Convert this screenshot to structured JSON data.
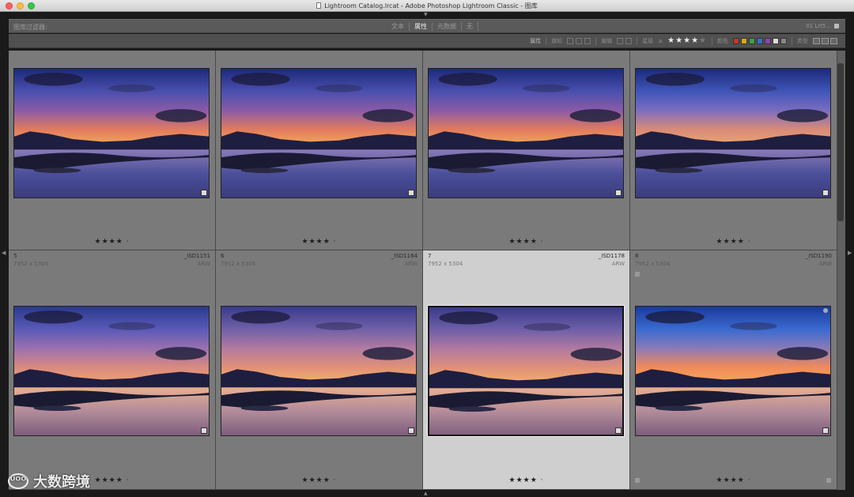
{
  "window": {
    "title": "Lightroom Catalog.lrcat - Adobe Photoshop Lightroom Classic - 图库"
  },
  "filterbar": {
    "label": "图库过滤器:",
    "tabs": [
      {
        "label": "文本",
        "active": false
      },
      {
        "label": "属性",
        "active": true
      },
      {
        "label": "元数据",
        "active": false
      },
      {
        "label": "无",
        "active": false
      }
    ],
    "preset": "01 Lrt5..."
  },
  "attrbar": {
    "attribute_label": "属性",
    "flag_label": "旗标",
    "edit_label": "编辑",
    "rating_label": "星级",
    "rating_op": "≥",
    "rating_stars": "★★★★",
    "rating_dim_star": "★",
    "color_label": "颜色",
    "type_label": "类型",
    "colors": [
      "#c0392b",
      "#d4b106",
      "#3fa142",
      "#3a6fcf",
      "#8e44ad",
      "#dddddd",
      "#888888"
    ]
  },
  "grid": {
    "rows": [
      [
        {
          "index": "",
          "filename": "",
          "dims": "",
          "ext": "",
          "rating": "★★★★ ·",
          "variant": "a"
        },
        {
          "index": "",
          "filename": "",
          "dims": "",
          "ext": "",
          "rating": "★★★★ ·",
          "variant": "a"
        },
        {
          "index": "",
          "filename": "",
          "dims": "",
          "ext": "",
          "rating": "★★★★ ·",
          "variant": "a"
        },
        {
          "index": "",
          "filename": "",
          "dims": "",
          "ext": "",
          "rating": "★★★★ ·",
          "variant": "b"
        }
      ],
      [
        {
          "index": "5",
          "filename": "_ISD1151",
          "dims": "7952 x 5304",
          "ext": "ARW",
          "rating": "★★★★ ·",
          "variant": "c"
        },
        {
          "index": "6",
          "filename": "_ISD1164",
          "dims": "7952 x 5304",
          "ext": "ARW",
          "rating": "★★★★ ·",
          "variant": "d"
        },
        {
          "index": "7",
          "filename": "_ISD1178",
          "dims": "7952 x 5304",
          "ext": "ARW",
          "rating": "★★★★ ·",
          "variant": "d",
          "selected": true
        },
        {
          "index": "8",
          "filename": "_ISD1190",
          "dims": "7952 x 5304",
          "ext": "ARW",
          "rating": "★★★★ ·",
          "variant": "e"
        }
      ]
    ]
  },
  "watermark": {
    "logo": "ᵁᴼᴼ",
    "text": "大数跨境"
  }
}
